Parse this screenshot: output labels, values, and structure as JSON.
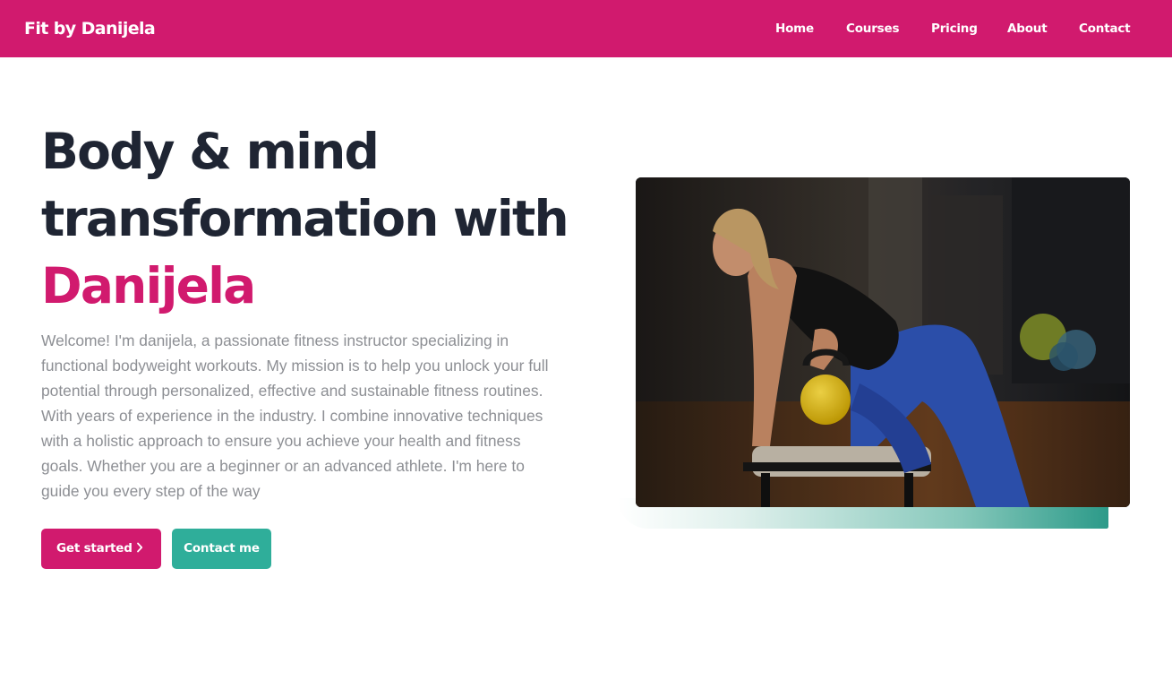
{
  "brand": {
    "name": "Fit by Danijela"
  },
  "nav": {
    "home": "Home",
    "courses": "Courses",
    "pricing": "Pricing",
    "about": "About",
    "contact": "Contact"
  },
  "hero": {
    "headline_line1": "Body & mind",
    "headline_line2": "transformation with",
    "headline_accent": "Danijela",
    "intro": "Welcome! I'm danijela, a passionate fitness instructor specializing in functional bodyweight workouts. My mission is to help you unlock your full potential through personalized, effective and sustainable fitness routines. With years of experience in the industry. I combine innovative techniques with a holistic approach to ensure you achieve your health and fitness goals. Whether you are a beginner or an advanced athlete. I'm here to guide you every step of the way",
    "primary_button": "Get started",
    "primary_button_icon": "chevron-right-icon",
    "secondary_button": "Contact me"
  },
  "colors": {
    "brand": "#d11a6e",
    "accent_teal": "#2fae9a",
    "heading": "#1f2533",
    "body_text": "#8d8f94"
  }
}
